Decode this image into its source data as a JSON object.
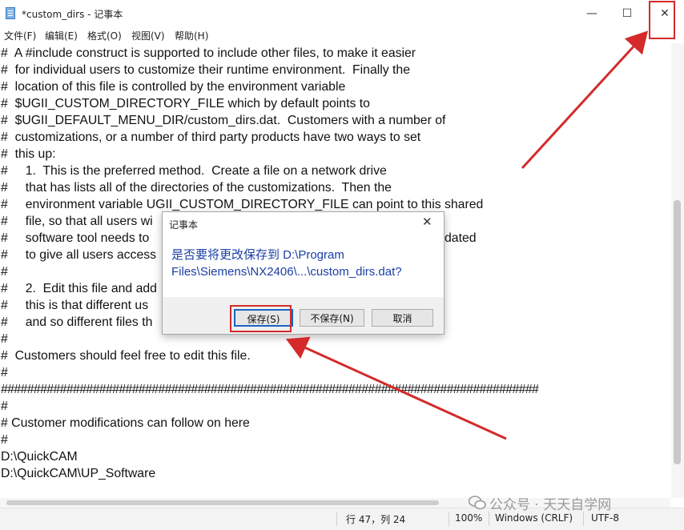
{
  "window": {
    "title": "*custom_dirs - 记事本",
    "minimize_glyph": "—",
    "maximize_glyph": "☐",
    "close_glyph": "✕"
  },
  "menu": [
    "文件(F)",
    "编辑(E)",
    "格式(O)",
    "视图(V)",
    "帮助(H)"
  ],
  "editor": {
    "lines": [
      "#  A #include construct is supported to include other files, to make it easier",
      "#  for individual users to customize their runtime environment.  Finally the",
      "#  location of this file is controlled by the environment variable",
      "#  $UGII_CUSTOM_DIRECTORY_FILE which by default points to",
      "#  $UGII_DEFAULT_MENU_DIR/custom_dirs.dat.  Customers with a number of",
      "#  customizations, or a number of third party products have two ways to set",
      "#  this up:",
      "#     1.  This is the preferred method.  Create a file on a network drive",
      "#     that has lists all of the directories of the customizations.  Then the",
      "#     environment variable UGII_CUSTOM_DIRECTORY_FILE can point to this shared",
      "#     file, so that all users wi",
      "#     software tool needs to",
      "#     to give all users access",
      "#",
      "#     2.  Edit this file and add",
      "#     this is that different us",
      "#     and so different files th",
      "#",
      "#  Customers should feel free to edit this file.",
      "#",
      "##################################################################################",
      "#",
      "# Customer modifications can follow on here",
      "#",
      "D:\\QuickCAM",
      "D:\\QuickCAM\\UP_Software"
    ],
    "behind_dialog_fragment": "dated"
  },
  "status": {
    "position": "行 47，列 24",
    "zoom": "100%",
    "line_ending": "Windows (CRLF)",
    "encoding": "UTF-8"
  },
  "watermark": "公众号 · 天天自学网",
  "dialog": {
    "title": "记事本",
    "close_glyph": "✕",
    "message_line1": "是否要将更改保存到 D:\\Program",
    "message_line2": "Files\\Siemens\\NX2406\\...\\custom_dirs.dat?",
    "save_label": "保存(S)",
    "nosave_label": "不保存(N)",
    "cancel_label": "取消"
  },
  "colors": {
    "annotation_red": "#d42a2a",
    "dialog_message_blue": "#1a3fa4",
    "default_button_border": "#1a65c0"
  }
}
